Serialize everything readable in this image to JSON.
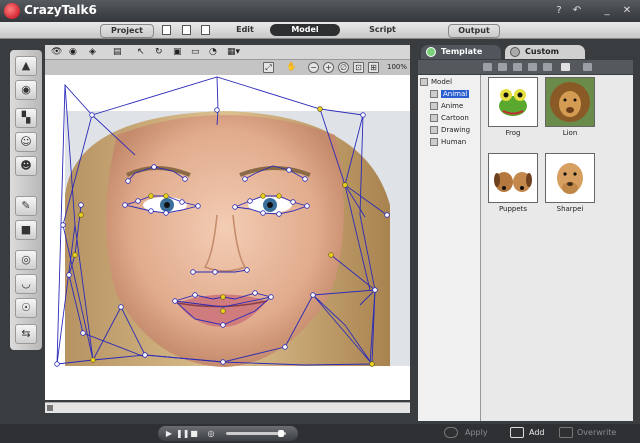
{
  "app": {
    "title": "CrazyTalk6"
  },
  "window_controls": [
    "?",
    "↶",
    "_",
    "✕"
  ],
  "mode_tabs": {
    "project": "Project",
    "edit": "Edit",
    "model": "Model",
    "script": "Script",
    "output": "Output"
  },
  "view": {
    "zoom": "100%"
  },
  "panel": {
    "tab_template": "Template",
    "tab_custom": "Custom",
    "tree_root": "Model",
    "tree_items": [
      "Animal",
      "Anime",
      "Cartoon",
      "Drawing",
      "Human"
    ],
    "selected_item": "Animal",
    "thumbnails": [
      {
        "label": "Frog",
        "icon": "frog-thumbnail"
      },
      {
        "label": "Lion",
        "icon": "lion-thumbnail"
      },
      {
        "label": "Puppets",
        "icon": "puppets-thumbnail"
      },
      {
        "label": "Sharpei",
        "icon": "sharpei-thumbnail"
      }
    ],
    "actions": {
      "apply": "Apply",
      "add": "Add",
      "overwrite": "Overwrite"
    }
  },
  "colors": {
    "accent": "#2a5fcf",
    "mesh": "#2b2bb8",
    "selected_point": "#e8d020"
  }
}
